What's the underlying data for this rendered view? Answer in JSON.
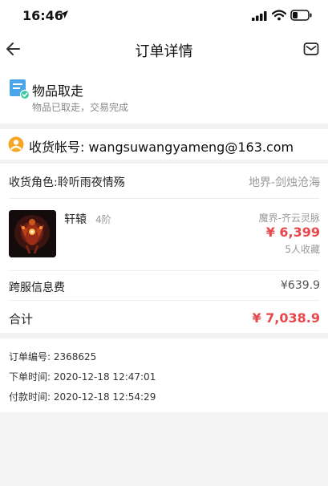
{
  "status_bar": {
    "time": "16:46"
  },
  "nav": {
    "title": "订单详情"
  },
  "order_status": {
    "title": "物品取走",
    "subtitle": "物品已取走，交易完成"
  },
  "account": {
    "text": "收货帐号: wangsuwangyameng@163.com"
  },
  "role": {
    "label": "收货角色:聆听雨夜情殇",
    "server": "地界-剑烛沧海"
  },
  "product": {
    "name": "轩辕",
    "level": "4阶",
    "server": "魔界-齐云灵脉",
    "price": "¥ 6,399",
    "favorites": "5人收藏"
  },
  "fee": {
    "label": "跨服信息费",
    "value": "¥639.9"
  },
  "total": {
    "label": "合计",
    "value": "¥ 7,038.9"
  },
  "order_info": [
    {
      "key": "订单编号:",
      "value": "2368625"
    },
    {
      "key": "下单时间:",
      "value": "2020-12-18 12:47:01"
    },
    {
      "key": "付款时间:",
      "value": "2020-12-18 12:54:29"
    }
  ],
  "colors": {
    "price": "#e8484b",
    "accent": "#4aa6e8",
    "account_icon": "#f5a623"
  }
}
